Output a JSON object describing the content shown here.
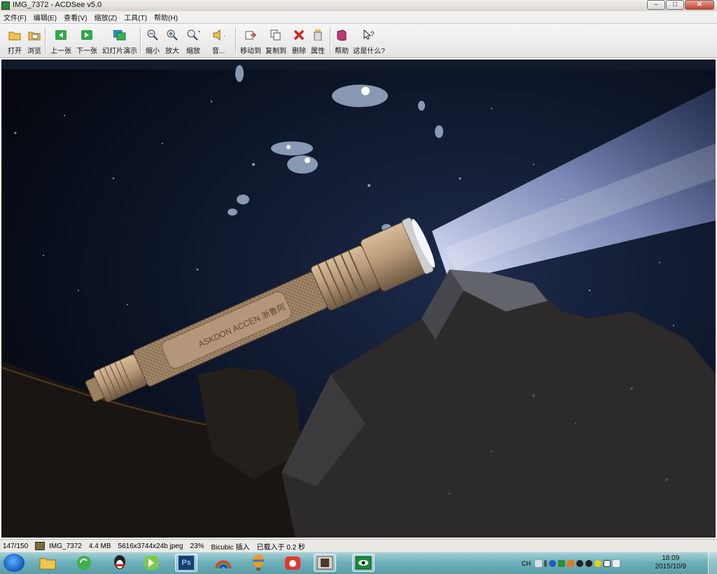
{
  "window": {
    "title": "IMG_7372 - ACDSee v5.0",
    "min": "–",
    "max": "□",
    "close": "✕"
  },
  "menu": [
    "文件(F)",
    "编辑(E)",
    "查看(V)",
    "缩放(Z)",
    "工具(T)",
    "帮助(H)"
  ],
  "toolbar": {
    "open": "打开",
    "browse": "浏览",
    "prev": "上一张",
    "next": "下一张",
    "slideshow": "幻灯片演示",
    "zoom_out": "缩小",
    "zoom_in": "放大",
    "zoom": "缩放",
    "audio": "音...",
    "move_to": "移动到",
    "copy_to": "复制到",
    "delete": "删除",
    "properties": "属性",
    "help": "帮助",
    "whats_this": "这是什么?"
  },
  "photo_text": {
    "engraving": "ASKDON ACCEN 浙鲁阿"
  },
  "status": {
    "position": "147/150",
    "filename": "IMG_7372",
    "size": "4.4 MB",
    "dims": "5616x3744x24b jpeg",
    "zoom": "23%",
    "filter": "Bicubic 插入",
    "load_time": "已载入于 0.2 秒"
  },
  "taskbar": {
    "ps_label": "Ps",
    "lang": "CH"
  },
  "clock": {
    "time": "18:09",
    "date": "2015/10/9"
  },
  "colors": {
    "titlebar": "#d9d3cb",
    "taskbar": "#6eb0ba",
    "photo_bg": "#070b14",
    "flashlight": "#b89a78"
  }
}
